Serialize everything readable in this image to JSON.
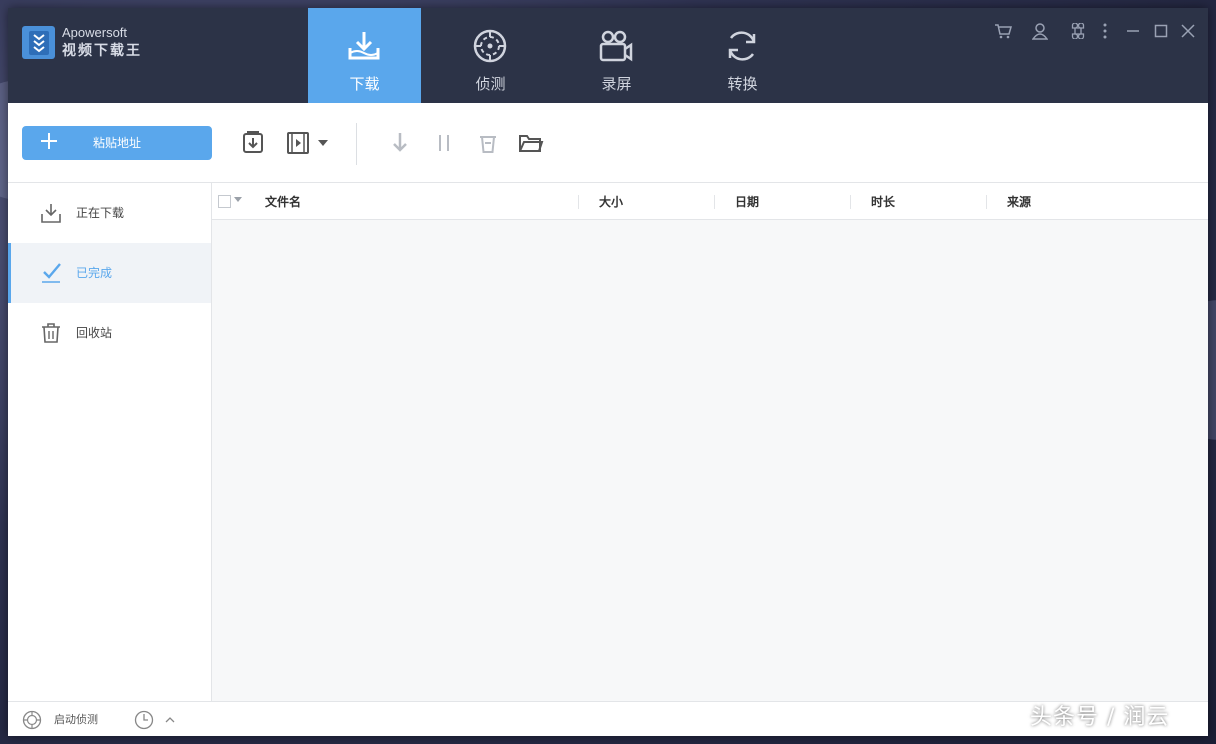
{
  "app": {
    "brand": "Apowersoft",
    "name": "视频下载王"
  },
  "nav": {
    "tabs": [
      {
        "label": "下载",
        "icon": "download-tray-icon",
        "active": true
      },
      {
        "label": "侦测",
        "icon": "radar-icon",
        "active": false
      },
      {
        "label": "录屏",
        "icon": "video-camera-icon",
        "active": false
      },
      {
        "label": "转换",
        "icon": "convert-icon",
        "active": false
      }
    ]
  },
  "window_controls": [
    "cart-icon",
    "user-icon",
    "command-icon",
    "more-icon",
    "minimize-icon",
    "maximize-icon",
    "close-icon"
  ],
  "toolbar": {
    "paste_label": "粘贴地址",
    "icons": [
      "download-box-icon",
      "video-file-icon",
      "dropdown-arrow-icon",
      "start-download-icon",
      "pause-icon",
      "delete-icon",
      "open-folder-icon"
    ]
  },
  "sidebar": {
    "items": [
      {
        "label": "正在下载",
        "icon": "download-icon",
        "active": false
      },
      {
        "label": "已完成",
        "icon": "check-icon",
        "active": true
      },
      {
        "label": "回收站",
        "icon": "trash-icon",
        "active": false
      }
    ]
  },
  "table": {
    "columns": [
      "文件名",
      "大小",
      "日期",
      "时长",
      "来源"
    ],
    "rows": []
  },
  "statusbar": {
    "detect_label": "启动侦测"
  },
  "watermark": "头条号 / 润云",
  "colors": {
    "titlebar": "#2c3347",
    "accent": "#5aa7ec",
    "content_bg": "#f7f8f9"
  }
}
